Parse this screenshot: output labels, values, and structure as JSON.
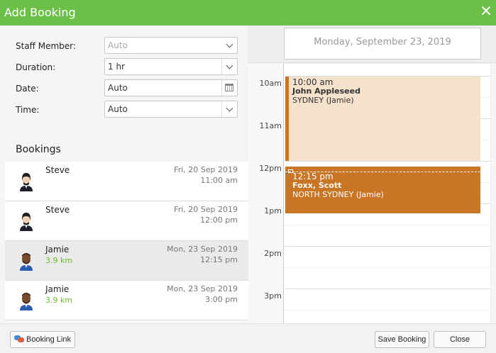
{
  "window": {
    "title": "Add Booking"
  },
  "form": {
    "staff_label": "Staff Member:",
    "staff_value": "Auto",
    "duration_label": "Duration:",
    "duration_value": "1 hr",
    "date_label": "Date:",
    "date_value": "Auto",
    "time_label": "Time:",
    "time_value": "Auto"
  },
  "bookings": {
    "heading": "Bookings",
    "items": [
      {
        "name": "Steve",
        "distance": "",
        "date": "Fri, 20 Sep 2019",
        "time": "11:00 am"
      },
      {
        "name": "Steve",
        "distance": "",
        "date": "Fri, 20 Sep 2019",
        "time": "12:00 pm"
      },
      {
        "name": "Jamie",
        "distance": "3.9 km",
        "date": "Mon, 23 Sep 2019",
        "time": "12:15 pm"
      },
      {
        "name": "Jamie",
        "distance": "3.9 km",
        "date": "Mon, 23 Sep 2019",
        "time": "3:00 pm"
      }
    ]
  },
  "calendar": {
    "day_header": "Monday, September 23, 2019",
    "hours": [
      "10am",
      "11am",
      "12pm",
      "1pm",
      "2pm",
      "3pm"
    ],
    "events": [
      {
        "time": "10:00 am",
        "name": "John Appleseed",
        "location": "SYDNEY (Jamie)",
        "color": "#f5e2cc",
        "accent": "#c87526"
      },
      {
        "time": "12:15 pm",
        "name": "Foxx, Scott",
        "location": "NORTH SYDNEY (Jamie)",
        "color": "#c87526"
      }
    ]
  },
  "footer": {
    "booking_link_label": "Booking Link",
    "save_label": "Save Booking",
    "close_label": "Close"
  },
  "colors": {
    "titlebar": "#6cc049",
    "event_primary": "#c87526",
    "distance_text": "#6cbb2e"
  }
}
